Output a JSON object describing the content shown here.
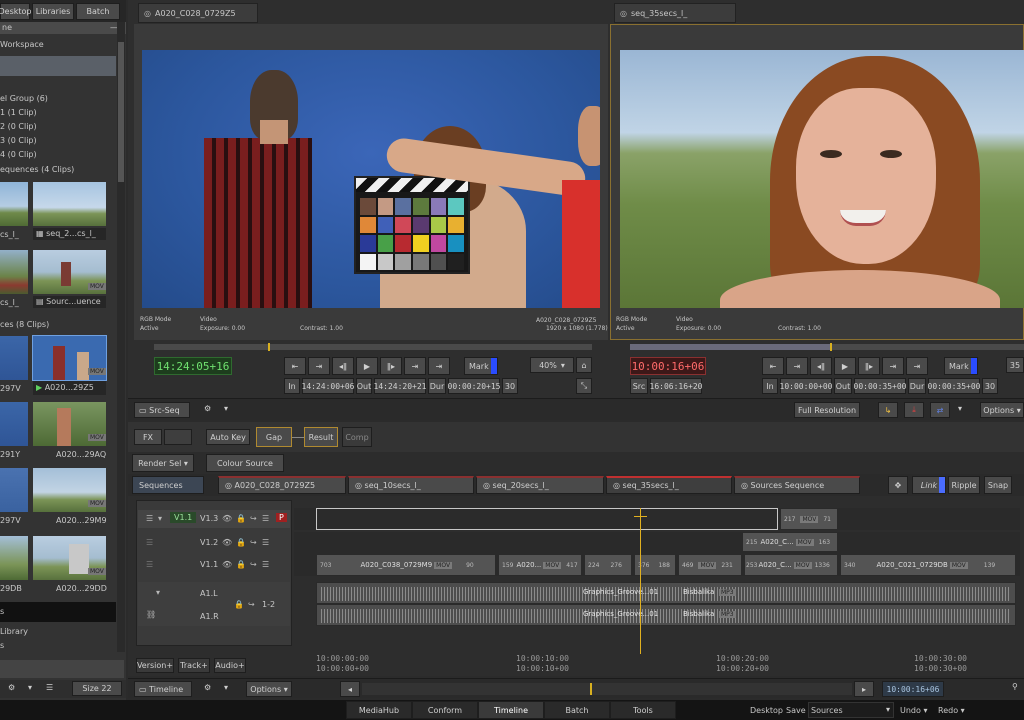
{
  "left_panel": {
    "tabs": [
      "Desktop",
      "Libraries",
      "Batch"
    ],
    "section_title": "ne",
    "workspace": "Workspace",
    "items": [
      "el Group (6)",
      "1 (1 Clip)",
      "2 (0 Clip)",
      "3 (0 Clip)",
      "4 (0 Clip)",
      "equences (4 Clips)"
    ],
    "seq_thumbs": [
      {
        "label": "cs_l_",
        "badge": ""
      },
      {
        "label": "seq_2...cs_l_",
        "badge": ""
      },
      {
        "label": "cs_l_",
        "badge": ""
      },
      {
        "label": "Sourc...uence",
        "badge": "MOV"
      }
    ],
    "sources_header": "ces (8 Clips)",
    "source_thumbs": [
      {
        "label": "297V",
        "badge": ""
      },
      {
        "label": "A020...29Z5",
        "badge": "MOV"
      },
      {
        "label": "291Y",
        "badge": ""
      },
      {
        "label": "A020...29AQ",
        "badge": "MOV"
      },
      {
        "label": "297V",
        "badge": ""
      },
      {
        "label": "A020...29M9",
        "badge": "MOV"
      },
      {
        "label": "29DB",
        "badge": ""
      },
      {
        "label": "A020...29DD",
        "badge": "MOV"
      }
    ],
    "bottom_items": [
      "s",
      "Library",
      "s"
    ],
    "size_label": "Size 22"
  },
  "viewer_left": {
    "tab": "A020_C028_0729Z5",
    "rgb_mode": "RGB Mode",
    "active": "Active",
    "video": "Video",
    "exposure": "Exposure: 0.00",
    "contrast": "Contrast: 1.00",
    "clip_name": "A020_C028_0729Z5",
    "resolution": "1920 x 1080 (1.778)",
    "timecode": "14:24:05+16",
    "mark": "Mark",
    "zoom": "40%",
    "in_label": "In",
    "in_tc": "14:24:00+06",
    "out_label": "Out",
    "out_tc": "14:24:20+21",
    "dur_label": "Dur",
    "dur_tc": "00:00:20+15",
    "fps": "30"
  },
  "viewer_right": {
    "tab": "seq_35secs_l_",
    "rgb_mode": "RGB Mode",
    "active": "Active",
    "video": "Video",
    "exposure": "Exposure: 0.00",
    "contrast": "Contrast: 1.00",
    "timecode": "10:00:16+06",
    "mark": "Mark",
    "src_label": "Src",
    "src_tc": "16:06:16+20",
    "in_label": "In",
    "in_tc": "10:00:00+00",
    "out_label": "Out",
    "out_tc": "00:00:35+00",
    "dur_label": "Dur",
    "dur_tc": "00:00:35+00",
    "fps": "30",
    "zoom_partial": "35"
  },
  "toolbar": {
    "src_seq": "Src-Seq",
    "full_res": "Full Resolution",
    "options": "Options",
    "fx": "FX",
    "auto_key": "Auto Key",
    "gap": "Gap",
    "result": "Result",
    "comp": "Comp",
    "render_sel": "Render Sel",
    "colour_source": "Colour Source"
  },
  "seq_tabs": {
    "sequences": "Sequences",
    "tabs": [
      "A020_C028_0729Z5",
      "seq_10secs_l_",
      "seq_20secs_l_",
      "seq_35secs_l_",
      "Sources Sequence"
    ],
    "link": "Link",
    "ripple": "Ripple",
    "snap": "Snap"
  },
  "tracks": {
    "v13": "V1.3",
    "v11_label": "V1.1",
    "v12": "V1.2",
    "v11": "V1.1",
    "a1l": "A1.L",
    "a1r": "A1.R",
    "a_patch": "1-2",
    "p_flag": "P"
  },
  "clips": {
    "top_num1": "217",
    "top_num2": "71",
    "mid_num1": "215",
    "mid_name": "A020_C...",
    "mid_num2": "163",
    "c1_num": "703",
    "c1_name": "A020_C038_0729M9",
    "c1_end": "90",
    "c2_num": "159",
    "c2_name": "A020...",
    "c2_end": "417",
    "c3_a": "224",
    "c3_b": "276",
    "c4_a": "376",
    "c4_b": "188",
    "c5_a": "469",
    "c5_b": "231",
    "c6_num": "253",
    "c6_name": "A020_C...",
    "c6_end": "1336",
    "c7_num": "340",
    "c7_name": "A020_C021_0729DB",
    "c7_end": "139",
    "mov": "MOV",
    "mp3": "MP3",
    "audio1": "Graphics_Groove...01",
    "audio2": "Bisbalika",
    "audio3": "Graphics_Groove...01",
    "audio4": "Bisbalika"
  },
  "ruler": {
    "marks": [
      {
        "top": "10:00:00:00",
        "bottom": "10:00:00+00"
      },
      {
        "top": "10:00:10:00",
        "bottom": "10:00:10+00"
      },
      {
        "top": "10:00:20:00",
        "bottom": "10:00:20+00"
      },
      {
        "top": "10:00:30:00",
        "bottom": "10:00:30+00"
      }
    ]
  },
  "bottom_bar": {
    "version": "Version+",
    "track": "Track+",
    "audio": "Audio+",
    "timeline": "Timeline",
    "options": "Options",
    "tc": "10:00:16+06"
  },
  "footer": {
    "tabs": [
      "MediaHub",
      "Conform",
      "Timeline",
      "Batch",
      "Tools"
    ],
    "active_tab": "Timeline",
    "desktop": "Desktop",
    "save": "Save",
    "sources": "Sources",
    "undo": "Undo",
    "redo": "Redo"
  }
}
